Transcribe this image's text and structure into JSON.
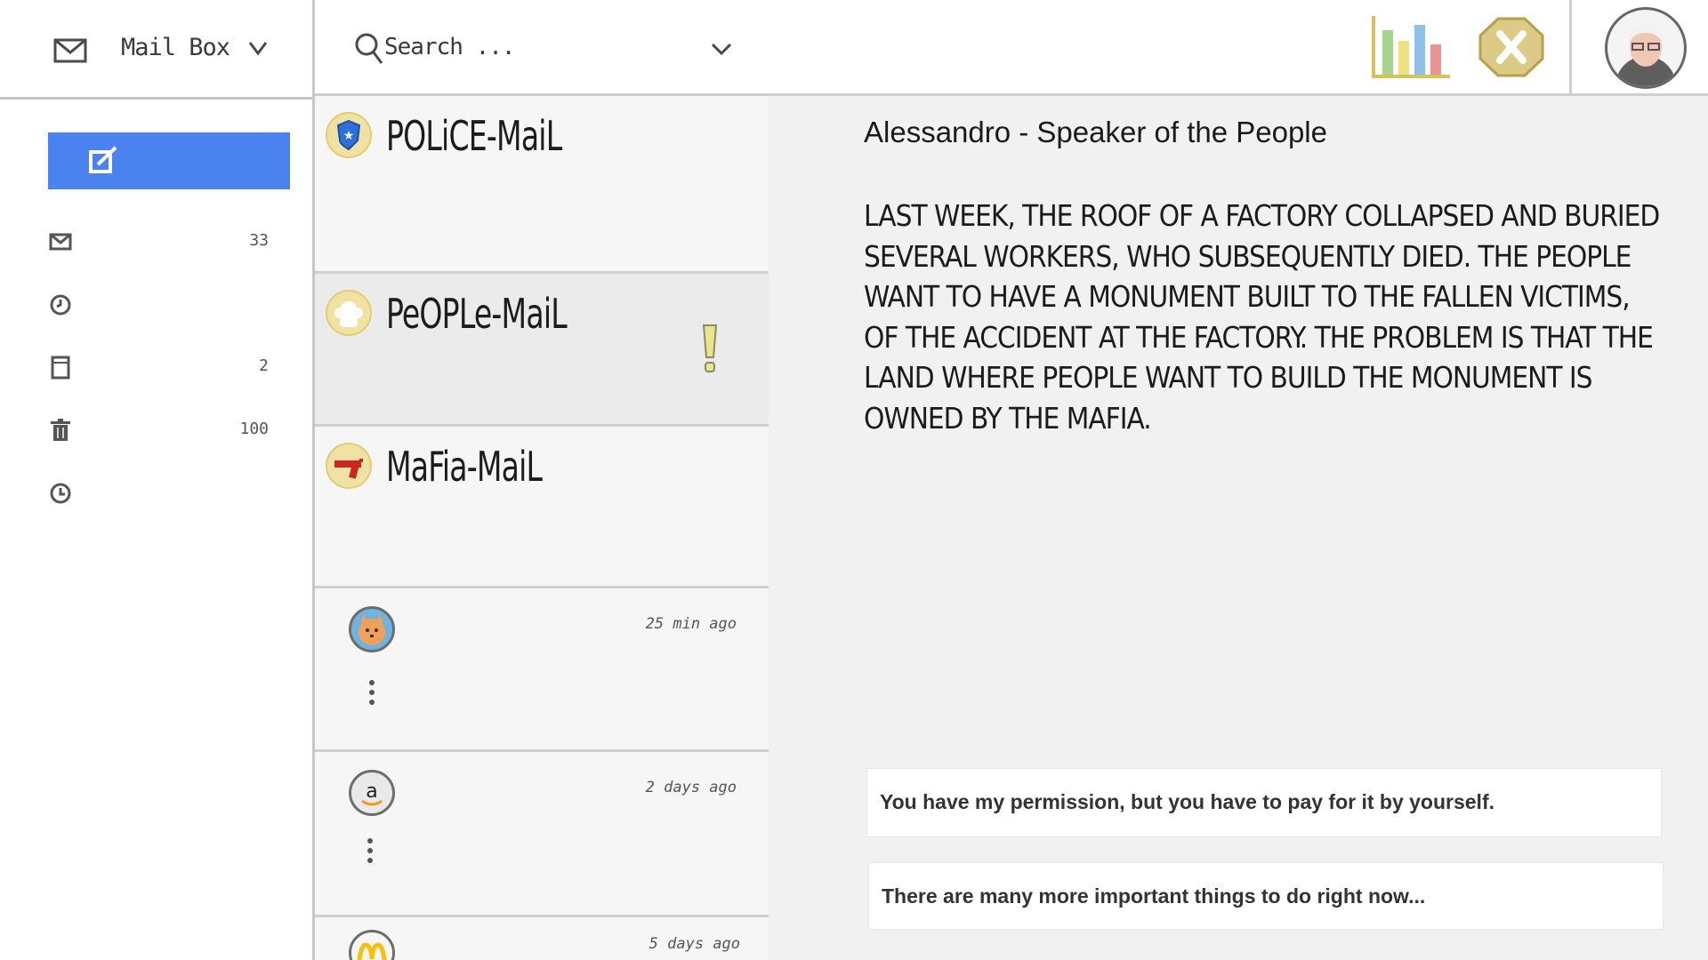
{
  "sidebar": {
    "mailbox_label": "Mail Box",
    "compose_label": "",
    "folders": [
      {
        "name": "inbox",
        "count": "33"
      },
      {
        "name": "recent",
        "count": ""
      },
      {
        "name": "saved",
        "count": "2"
      },
      {
        "name": "trash",
        "count": "100"
      },
      {
        "name": "history",
        "count": ""
      }
    ]
  },
  "search": {
    "placeholder": "Search ..."
  },
  "categories": [
    {
      "label": "POLiCE-MaiL",
      "icon": "police-badge-icon"
    },
    {
      "label": "PeOPLe-MaiL",
      "icon": "people-badge-icon",
      "flagged": true
    },
    {
      "label": "MaFia-MaiL",
      "icon": "gun-badge-icon"
    }
  ],
  "messages": [
    {
      "avatar": "cat-avatar-icon",
      "time": "25 min ago"
    },
    {
      "avatar": "amazon-avatar-icon",
      "time": "2 days ago"
    },
    {
      "avatar": "mcdonalds-avatar-icon",
      "time": "5 days ago"
    }
  ],
  "email": {
    "sender": "Alessandro - Speaker of the People",
    "body": "Last week, the roof of a factory collapsed and buried several workers, who subsequently died. The people want to have a monument built to the fallen victims, of the accident at the factory. The problem is that the land where people want to build the monument is owned by the mafia."
  },
  "replies": [
    "You have my permission, but you have to pay for it by yourself.",
    "There are many more important things to do right now..."
  ],
  "colors": {
    "accent": "#4a83ef",
    "badge": "#efe2a2"
  }
}
